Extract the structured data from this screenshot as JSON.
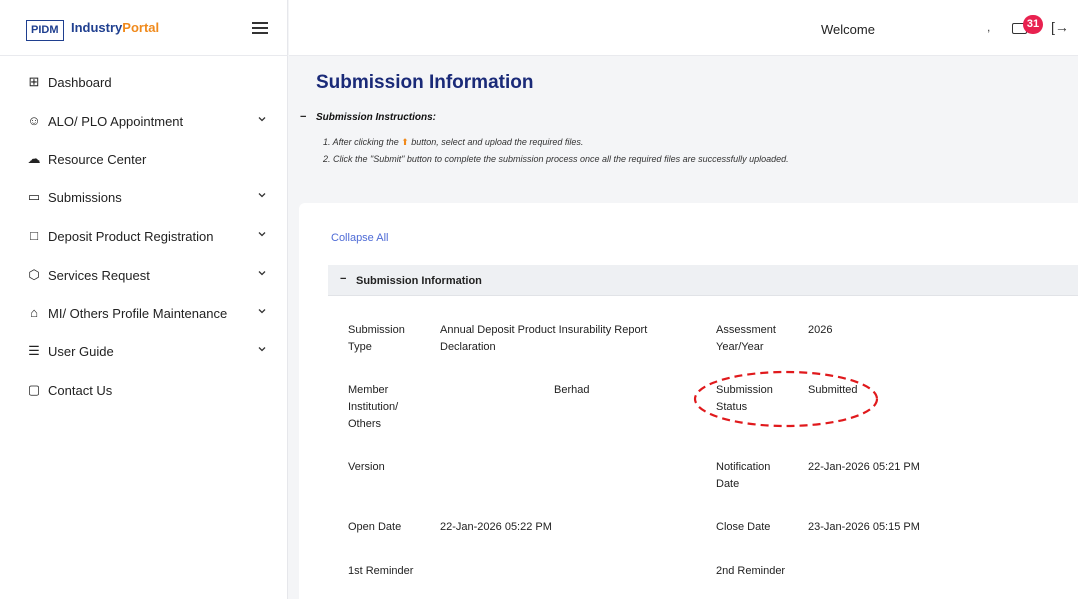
{
  "brand": {
    "logo": "PIDM",
    "name_part1": "Industry",
    "name_part2": "Portal"
  },
  "sidebar": {
    "items": [
      {
        "label": "Dashboard",
        "icon": "grid-icon",
        "glyph": "⊞"
      },
      {
        "label": "ALO/ PLO Appointment",
        "icon": "user-add-icon",
        "glyph": "☺"
      },
      {
        "label": "Resource Center",
        "icon": "cloud-download-icon",
        "glyph": "☁"
      },
      {
        "label": "Submissions",
        "icon": "folder-icon",
        "glyph": "▭"
      },
      {
        "label": "Deposit Product Registration",
        "icon": "document-icon",
        "glyph": "□"
      },
      {
        "label": "Services Request",
        "icon": "box-icon",
        "glyph": "⬡"
      },
      {
        "label": "MI/ Others Profile Maintenance",
        "icon": "home-icon",
        "glyph": "⌂"
      },
      {
        "label": "User Guide",
        "icon": "book-icon",
        "glyph": "☰"
      },
      {
        "label": "Contact Us",
        "icon": "chat-icon",
        "glyph": "▢"
      }
    ]
  },
  "header": {
    "welcome": "Welcome",
    "separator": ",",
    "notification_count": "31",
    "logout_glyph": "[→"
  },
  "main": {
    "title": "Submission Information",
    "instructions": {
      "toggle": "−",
      "title": "Submission Instructions:",
      "line1_prefix": "1. After clicking the",
      "line1_icon": "⬆",
      "line1_suffix": "button, select and upload the required files.",
      "line2": "2. Click the \"Submit\" button to complete the submission process once all the required files are successfully uploaded."
    },
    "collapse_all": "Collapse All",
    "section": {
      "toggle": "−",
      "title": "Submission Information",
      "fields": {
        "submission_type_label_1": "Submission",
        "submission_type_label_2": "Type",
        "submission_type_value_1": "Annual Deposit Product Insurability Report",
        "submission_type_value_2": "Declaration",
        "assessment_year_label_1": "Assessment",
        "assessment_year_label_2": "Year/Year",
        "assessment_year_value": "2026",
        "member_label_1": "Member",
        "member_label_2": "Institution/",
        "member_label_3": "Others",
        "member_value": "Berhad",
        "status_label_1": "Submission",
        "status_label_2": "Status",
        "status_value": "Submitted",
        "version_label": "Version",
        "version_value": "",
        "notification_label_1": "Notification",
        "notification_label_2": "Date",
        "notification_value": "22-Jan-2026 05:21 PM",
        "open_date_label": "Open Date",
        "open_date_value": "22-Jan-2026 05:22 PM",
        "close_date_label": "Close Date",
        "close_date_value": "23-Jan-2026 05:15 PM",
        "reminder1_label": "1st Reminder",
        "reminder1_value": "",
        "reminder2_label": "2nd Reminder",
        "reminder2_value": ""
      }
    }
  },
  "colors": {
    "title": "#1a2a78",
    "accent": "#f08a1c",
    "link": "#4e6bd6",
    "badge": "#e8214f",
    "annotation": "#e0191c"
  }
}
